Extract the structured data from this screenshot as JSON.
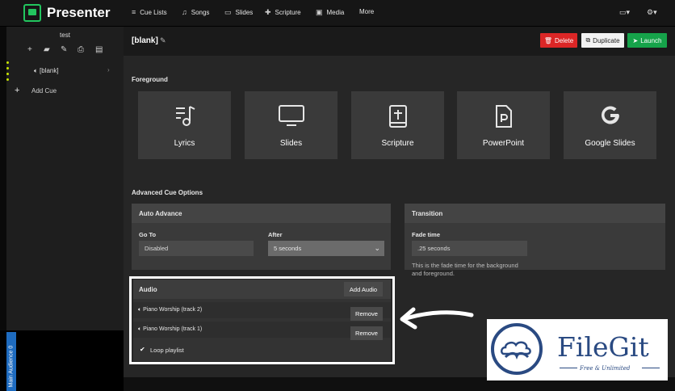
{
  "app": {
    "title": "Presenter"
  },
  "topnav": [
    {
      "icon": "≡",
      "label": "Cue Lists"
    },
    {
      "icon": "♫",
      "label": "Songs"
    },
    {
      "icon": "▭",
      "label": "Slides"
    },
    {
      "icon": "✚",
      "label": "Scripture"
    },
    {
      "icon": "▣",
      "label": "Media"
    },
    {
      "label": "More"
    }
  ],
  "sidebar": {
    "list_title": "test",
    "tools": [
      "+",
      "▰",
      "✎",
      "⎙",
      "▤"
    ],
    "cue_label": "[blank]",
    "add_cue_label": "Add Cue",
    "audience_tab": "Main Audience",
    "audience_count": "0"
  },
  "header": {
    "cue_title": "[blank]",
    "delete_label": "Delete",
    "duplicate_label": "Duplicate",
    "launch_label": "Launch"
  },
  "foreground": {
    "section_label": "Foreground",
    "tiles": [
      {
        "icon": "lyrics-icon",
        "label": "Lyrics"
      },
      {
        "icon": "monitor-icon",
        "label": "Slides"
      },
      {
        "icon": "bible-icon",
        "label": "Scripture"
      },
      {
        "icon": "powerpoint-file-icon",
        "label": "PowerPoint"
      },
      {
        "icon": "google-icon",
        "label": "Google Slides"
      }
    ]
  },
  "advanced": {
    "section_label": "Advanced Cue Options",
    "auto_advance": {
      "title": "Auto Advance",
      "goto_label": "Go To",
      "goto_value": "Disabled",
      "after_label": "After",
      "after_value": "5 seconds"
    },
    "transition": {
      "title": "Transition",
      "fade_label": "Fade time",
      "fade_value": ".25 seconds",
      "fade_help_1": "This is the fade time for the background",
      "fade_help_2": "and foreground."
    }
  },
  "audio": {
    "title": "Audio",
    "add_label": "Add Audio",
    "tracks": [
      {
        "name": "Piano Worship (track 2)",
        "remove_label": "Remove"
      },
      {
        "name": "Piano Worship (track 1)",
        "remove_label": "Remove"
      }
    ],
    "loop_label": "Loop playlist"
  },
  "watermark": {
    "name": "FileGit",
    "tagline": "Free & Unlimited"
  },
  "colors": {
    "brand_green": "#22c55e",
    "delete_red": "#dc2626",
    "launch_green": "#16a34a",
    "watermark_blue": "#2a4a82"
  }
}
